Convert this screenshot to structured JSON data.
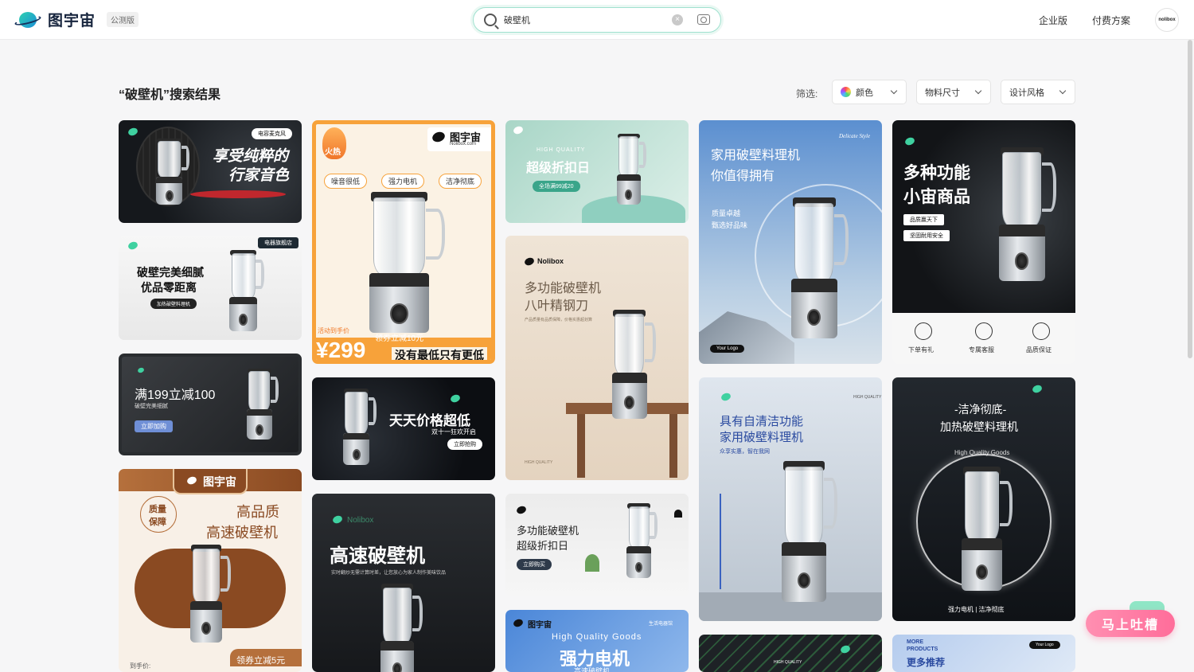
{
  "header": {
    "logo_text": "图宇宙",
    "beta_badge": "公测版",
    "search_value": "破壁机",
    "nav": [
      "企业版",
      "付费方案"
    ],
    "avatar_text": "nolibox"
  },
  "results": {
    "title": "“破壁机”搜索结果",
    "filter_label": "筛选:",
    "filters": [
      "颜色",
      "物料尺寸",
      "设计风格"
    ]
  },
  "cards": {
    "c1": {
      "badge": "电容麦克风",
      "title1": "享受纯粹的",
      "title2": "行家音色"
    },
    "c2": {
      "badge": "电器旗舰店",
      "title1": "破壁完美细腻",
      "title2": "优品零距离",
      "pill": "加热破壁料理机"
    },
    "c3": {
      "title1": "满199立减100",
      "sub": "破壁完美细腻",
      "pill": "立即加购"
    },
    "c4": {
      "brand": "图宇宙",
      "seal1": "质量",
      "seal2": "保障",
      "title1": "高品质",
      "title2": "高速破壁机",
      "foot_left": "到手价:",
      "foot_right": "领券立减5元"
    },
    "c5": {
      "hot": "火热",
      "brand": "图宇宙",
      "brand_sub": "Nolibox.com",
      "tags": [
        "噪音很低",
        "强力电机",
        "洁净彻底"
      ],
      "price_label": "活动到手价",
      "price": "¥299",
      "coupon": "领券立减10元",
      "slogan": "没有最低只有更低"
    },
    "c6": {
      "title": "天天价格超低",
      "sub": "双十一狂欢开启",
      "pill": "立即抢购"
    },
    "c7": {
      "brand": "Nolibox",
      "title": "高速破壁机",
      "sub": "实时翻炒无需计算时差，让您放心为家人制作美味饮品"
    },
    "c8": {
      "eyebrow": "HIGH QUALITY",
      "title": "超级折扣日",
      "pill": "全场满99减20"
    },
    "c9": {
      "brand": "Nolibox",
      "title1": "多功能破壁机",
      "title2": "八叶精钢刀",
      "sub": "产品质量有品质保障，价格实惠超划算",
      "foot": "HIGH QUALITY"
    },
    "c10": {
      "title1": "多功能破壁机",
      "title2": "超级折扣日",
      "pill": "立即购买"
    },
    "c11": {
      "brand": "图宇宙",
      "badge": "生活电器馆",
      "en": "High Quality Goods",
      "title": "强力电机",
      "sub": "高速破壁机"
    },
    "c12": {
      "corner": "Delicate Style",
      "title1": "家用破壁料理机",
      "title2": "你值得拥有",
      "sub1": "质量卓越",
      "sub2": "甄选好品味",
      "logo": "Your Logo"
    },
    "c13": {
      "badge": "HIGH QUALITY",
      "title1": "具有自清洁功能",
      "title2": "家用破壁料理机",
      "sub": "众享实惠，智在我网"
    },
    "c14": {
      "label": "HIGH QUALITY"
    },
    "c15": {
      "title1": "多种功能",
      "title2": "小宙商品",
      "tag1": "品质赢天下",
      "tag2": "坚固耐用安全",
      "icons": [
        "下单有礼",
        "专属客服",
        "品质保证"
      ]
    },
    "c16": {
      "title1": "-洁净彻底-",
      "title2": "加热破壁料理机",
      "en": "High Quality Goods",
      "foot": "强力电机 | 洁净彻底"
    },
    "c17": {
      "logo": "Your Logo",
      "en1": "MORE",
      "en2": "PRODUCTS",
      "title": "更多推荐"
    }
  },
  "feedback": {
    "label": "马上吐槽"
  },
  "colors": {
    "accent": "#3fd1a0",
    "orange": "#f7a23a",
    "brown": "#8a4a22",
    "pink": "#ff6d9a"
  }
}
